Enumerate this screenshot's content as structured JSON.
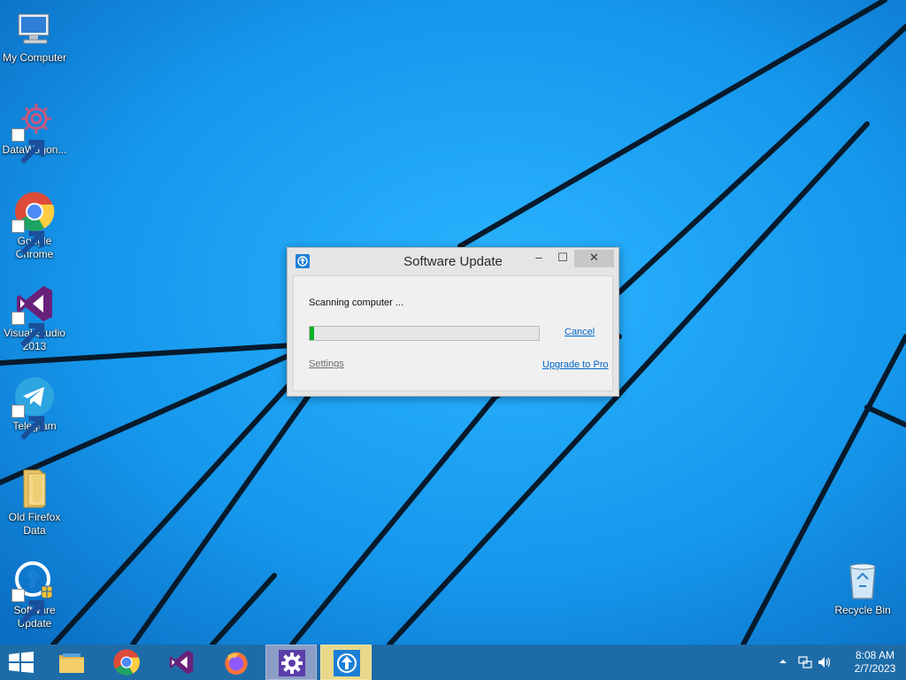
{
  "desktop": {
    "icons": [
      {
        "label": "My Computer",
        "name": "my-computer"
      },
      {
        "label": "DataWagon...",
        "name": "datawagon"
      },
      {
        "label": "Google Chrome",
        "name": "google-chrome"
      },
      {
        "label": "Visual Studio 2013",
        "name": "visual-studio-2013"
      },
      {
        "label": "Telegram",
        "name": "telegram"
      },
      {
        "label": "Old Firefox Data",
        "name": "old-firefox-data"
      },
      {
        "label": "Software Update",
        "name": "software-update"
      },
      {
        "label": "Recycle Bin",
        "name": "recycle-bin"
      }
    ]
  },
  "dialog": {
    "title": "Software Update",
    "min_glyph": "–",
    "max_glyph": "☐",
    "close_glyph": "✕",
    "status": "Scanning computer ...",
    "progress_percent": 2,
    "cancel": "Cancel",
    "settings": "Settings",
    "upgrade": "Upgrade to Pro"
  },
  "taskbar": {
    "apps": [
      "file-explorer",
      "google-chrome",
      "visual-studio",
      "firefox",
      "settings",
      "software-update"
    ],
    "clock_time": "8:08 AM",
    "clock_date": "2/7/2023"
  },
  "colors": {
    "wallpaper": "#1a8fe6",
    "progress": "#06b025",
    "link": "#0066cc"
  }
}
